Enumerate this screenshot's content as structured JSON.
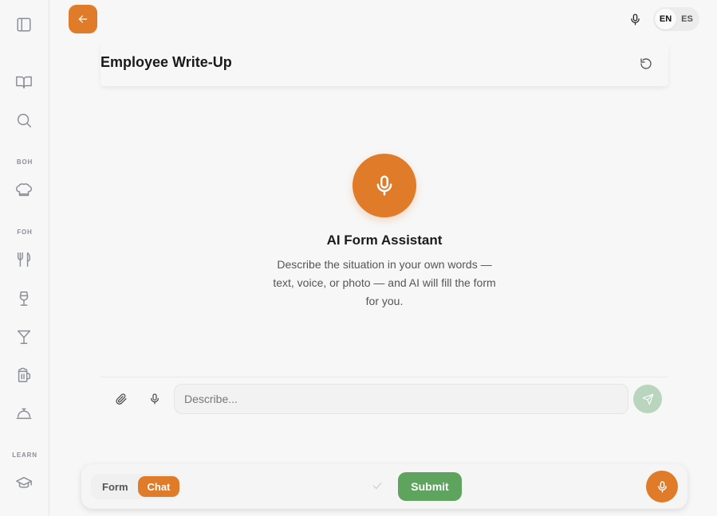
{
  "sidebar": {
    "sections": {
      "boh": "BOH",
      "foh": "FOH",
      "learn": "LEARN"
    },
    "icons": [
      "sidebar-toggle-icon",
      "book-icon",
      "search-icon",
      "chef-hat-icon",
      "fork-knife-icon",
      "wine-glass-icon",
      "cocktail-icon",
      "beer-mug-icon",
      "service-bell-icon",
      "graduation-cap-icon"
    ]
  },
  "header": {
    "language": {
      "options": [
        "EN",
        "ES"
      ],
      "selected": "EN"
    }
  },
  "form": {
    "title": "Employee Write-Up"
  },
  "assistant": {
    "title": "AI Form Assistant",
    "description": "Describe the situation in your own words — text, voice, or photo — and AI will fill the form for you."
  },
  "composer": {
    "placeholder": "Describe...",
    "value": ""
  },
  "bottom_bar": {
    "modes": [
      "Form",
      "Chat"
    ],
    "selected_mode": "Chat",
    "submit_label": "Submit"
  },
  "colors": {
    "accent": "#e07b2a",
    "submit": "#5ea35e",
    "send_disabled": "#b9d5bd",
    "background": "#f7f7f7"
  }
}
